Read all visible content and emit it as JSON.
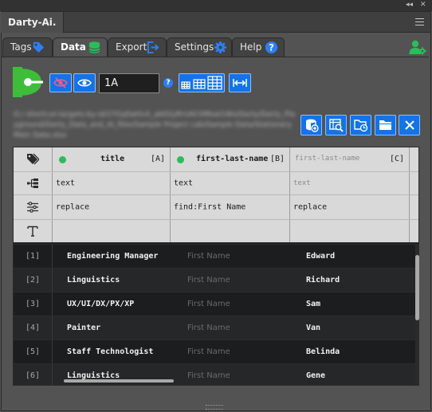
{
  "panel": {
    "title": "Darty-Ai.",
    "strip_controls": {
      "collapse": "◂◂",
      "close": "✕"
    }
  },
  "tabs": [
    {
      "label": "Tags",
      "icon": "tag-icon",
      "color": "#2d7ff0",
      "active": false
    },
    {
      "label": "Data",
      "icon": "database-icon",
      "color": "#2bbd5a",
      "active": true
    },
    {
      "label": "Export",
      "icon": "export-icon",
      "color": "#2d7ff0",
      "active": false
    },
    {
      "label": "Settings",
      "icon": "gear-icon",
      "color": "#2d7ff0",
      "active": false
    },
    {
      "label": "Help",
      "icon": "help-icon",
      "color": "#2d7ff0",
      "active": false
    }
  ],
  "toolbar": {
    "cell_value": "1A",
    "help_glyph": "?",
    "buttons": [
      "hide-icon",
      "show-icon",
      "table-size-icon",
      "fit-width-icon"
    ]
  },
  "source": {
    "path_text": "G:/ shortcut-targets-by-id/1YGqSwtlvX_ab02yRrUAC0Moal1Ws/Darty/Darty_Playground/Darty_Data_and_AI_files/Sample Project Lab/Sample Data/Stationery Main Data.xlsx",
    "buttons": [
      "load-data-icon",
      "preview-data-icon",
      "open-folder-icon",
      "folder-icon",
      "close-icon"
    ]
  },
  "grid": {
    "columns": [
      {
        "title": "title",
        "letter": "[A]",
        "type": "text",
        "action": "replace",
        "active": true
      },
      {
        "title": "first-last-name",
        "letter": "[B]",
        "type": "text",
        "action": "find:First Name",
        "active": true
      },
      {
        "title": "first-last-name",
        "letter": "[C]",
        "type": "text",
        "action": "replace",
        "active": false
      }
    ],
    "rows": [
      {
        "num": "[1]",
        "a": "Engineering Manager",
        "b": "First Name",
        "c": "Edward"
      },
      {
        "num": "[2]",
        "a": "Linguistics",
        "b": "First Name",
        "c": "Richard"
      },
      {
        "num": "[3]",
        "a": "UX/UI/DX/PX/XP",
        "b": "First Name",
        "c": "Sam"
      },
      {
        "num": "[4]",
        "a": "Painter",
        "b": "First Name",
        "c": "Van"
      },
      {
        "num": "[5]",
        "a": "Staff Technologist",
        "b": "First Name",
        "c": "Belinda"
      },
      {
        "num": "[6]",
        "a": "Linguistics",
        "b": "First Name",
        "c": "Gene"
      }
    ]
  },
  "colors": {
    "accent_blue": "#1473e6",
    "status_green": "#2bbd5a",
    "logo_green": "#3ebd3a"
  }
}
